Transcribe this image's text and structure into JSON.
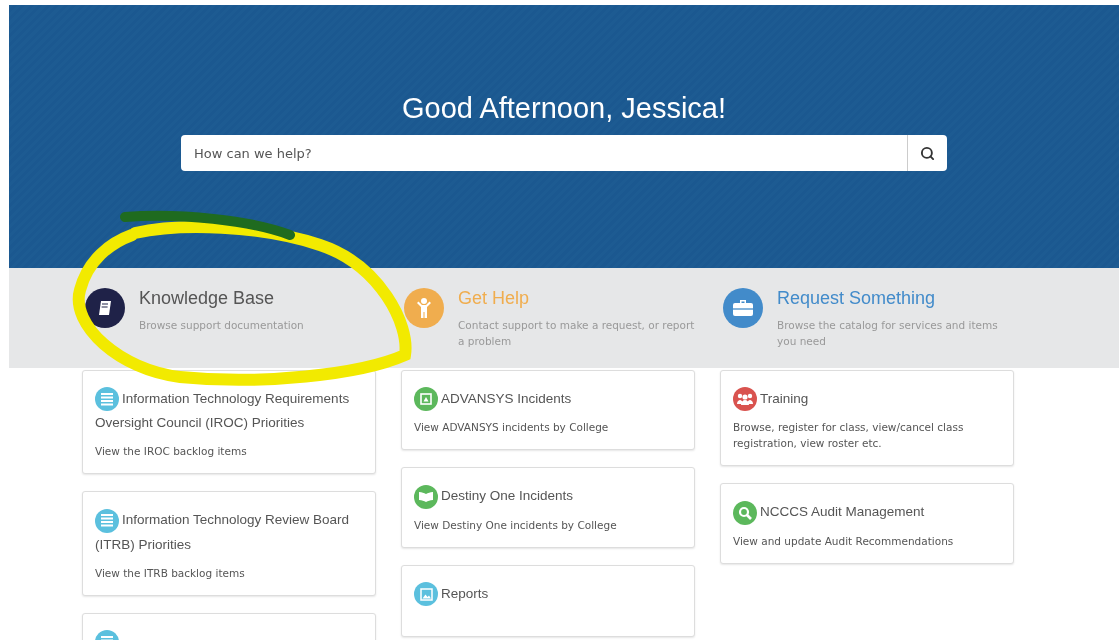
{
  "hero": {
    "greeting": "Good Afternoon, Jessica!",
    "search": {
      "placeholder": "How can we help?"
    }
  },
  "categories": [
    {
      "title": "Knowledge Base",
      "description": "Browse support documentation",
      "color": "#1f2248",
      "kind": "book"
    },
    {
      "title": "Get Help",
      "description": "Contact support to make a request, or report a problem",
      "color": "#f0ad4e",
      "kind": "person"
    },
    {
      "title": "Request Something",
      "description": "Browse the catalog for services and items you need",
      "color": "#428bca",
      "kind": "briefcase"
    }
  ],
  "columns": [
    {
      "cards": [
        {
          "title": "Information Technology Requirements Oversight Council (IROC) Priorities",
          "description": "View the IROC backlog items",
          "color": "#5bc0de",
          "kind": "list"
        },
        {
          "title": "Information Technology Review Board (ITRB) Priorities",
          "description": "View the ITRB backlog items",
          "color": "#5bc0de",
          "kind": "list"
        },
        {
          "color": "#5bc0de",
          "kind": "list"
        }
      ]
    },
    {
      "cards": [
        {
          "title": "ADVANSYS Incidents",
          "description": "View ADVANSYS incidents by College",
          "color": "#5cb85c",
          "kind": "square"
        },
        {
          "title": "Destiny One Incidents",
          "description": "View Destiny One incidents by College",
          "color": "#5cb85c",
          "kind": "openbook"
        },
        {
          "title": "Reports",
          "color": "#5bc0de",
          "kind": "image"
        }
      ]
    },
    {
      "cards": [
        {
          "title": "Training",
          "description": "Browse, register for class, view/cancel class registration, view roster etc.",
          "color": "#d9534f",
          "kind": "group"
        },
        {
          "title": "NCCCS Audit Management",
          "description": "View and update Audit Recommendations",
          "color": "#5cb85c",
          "kind": "search"
        }
      ]
    }
  ]
}
